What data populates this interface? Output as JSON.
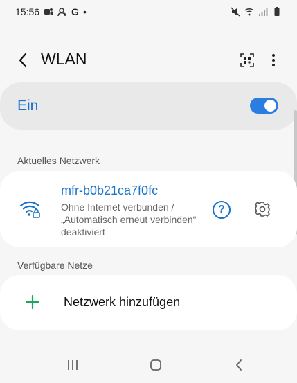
{
  "status_bar": {
    "time": "15:56",
    "google_letter": "G",
    "dot": "•",
    "left_icons": [
      "teams-icon",
      "account-icon",
      "google-icon",
      "notification-dot"
    ],
    "right_icons": [
      "mute-icon",
      "wifi-icon",
      "signal-icon",
      "battery-icon"
    ]
  },
  "app_bar": {
    "title": "WLAN",
    "icons": [
      "back-arrow-icon",
      "qr-scan-icon",
      "more-vert-icon"
    ]
  },
  "master_switch": {
    "label": "Ein",
    "state": "on"
  },
  "current_network_section": {
    "header": "Aktuelles Netzwerk",
    "network": {
      "ssid": "mfr-b0b21ca7f0fc",
      "status": "Ohne Internet verbunden / „Automatisch erneut verbinden“ deaktiviert",
      "help_glyph": "?",
      "icons": [
        "wifi-lock-icon",
        "help-icon",
        "settings-gear-icon"
      ]
    }
  },
  "available_section": {
    "header": "Verfügbare Netze",
    "add_network_label": "Netzwerk hinzufügen",
    "icon": "plus-icon"
  },
  "nav_bar": {
    "icons": [
      "recents-icon",
      "home-icon",
      "back-icon"
    ]
  },
  "colors": {
    "accent": "#1a73c9",
    "toggle_on": "#2a7de1",
    "plus_green": "#1ea561",
    "background": "#f6f6f6",
    "card": "#ffffff",
    "master_card": "#e9e9ea"
  }
}
